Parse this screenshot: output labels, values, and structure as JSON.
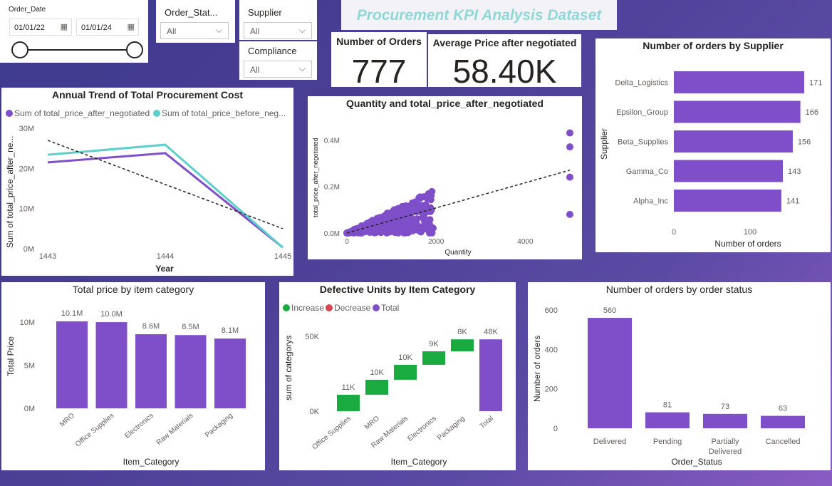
{
  "header": {
    "title": "Procurement KPI Analysis Dataset"
  },
  "slicers": {
    "order_date": {
      "label": "Order_Date",
      "start": "01/01/22",
      "end": "01/01/24"
    },
    "order_status": {
      "label": "Order_Stat...",
      "value": "All"
    },
    "supplier": {
      "label": "Supplier",
      "value": "All"
    },
    "compliance": {
      "label": "Compliance",
      "value": "All"
    }
  },
  "cards": {
    "orders": {
      "label": "Number of Orders",
      "value": "777"
    },
    "avg_price": {
      "label": "Average Price after negotiated",
      "value": "58.40K"
    }
  },
  "charts": {
    "annual_trend": {
      "title": "Annual Trend of Total Procurement Cost",
      "legend1": "Sum of total_price_after_negotiated",
      "legend2": "Sum of total_price_before_neg...",
      "ylabel": "Sum of total_price_after_ne...",
      "xlabel": "Year",
      "yticks": [
        "30M",
        "20M",
        "10M",
        "0M"
      ],
      "xticks": [
        "1443",
        "1444",
        "1445"
      ]
    },
    "scatter": {
      "title": "Quantity and total_price_after_negotiated",
      "ylabel": "total_price_after_negotiated",
      "xlabel": "Quantity",
      "yticks": [
        "0.4M",
        "0.2M",
        "0.0M"
      ],
      "xticks": [
        "0",
        "2000",
        "4000"
      ]
    },
    "supplier": {
      "title": "Number of orders by Supplier",
      "ylabel": "Supplier",
      "xlabel": "Number of orders",
      "xticks": [
        "0",
        "100"
      ]
    },
    "item_category": {
      "title": "Total price by item category",
      "ylabel": "Total Price",
      "xlabel": "Item_Category",
      "yticks": [
        "10M",
        "5M",
        "0M"
      ]
    },
    "defective": {
      "title": "Defective Units by Item Category",
      "legend": [
        "Increase",
        "Decrease",
        "Total"
      ],
      "ylabel": "sum of categorys",
      "xlabel": "Item_Category",
      "yticks": [
        "50K",
        "0K"
      ]
    },
    "order_status": {
      "title": "Number of orders by order status",
      "ylabel": "Number of orders",
      "xlabel": "Order_Status",
      "yticks": [
        "600",
        "400",
        "200",
        "0"
      ]
    }
  },
  "colors": {
    "purple": "#7f4fc9",
    "teal": "#5ecfcb",
    "green": "#1aab40",
    "red": "#d64550",
    "title_teal": "#8ed8d6"
  },
  "chart_data": [
    {
      "type": "line",
      "title": "Annual Trend of Total Procurement Cost",
      "x": [
        "1443",
        "1444",
        "1445"
      ],
      "series": [
        {
          "name": "Sum of total_price_after_negotiated",
          "values": [
            21.5,
            23.8,
            0.3
          ]
        },
        {
          "name": "Sum of total_price_before_neg...",
          "values": [
            23.4,
            25.9,
            0.3
          ]
        }
      ],
      "trend": [
        27,
        16,
        5
      ],
      "ylim": [
        0,
        30
      ],
      "xlabel": "Year",
      "ylabel": "Sum of total_price_after_ne..."
    },
    {
      "type": "scatter",
      "title": "Quantity and total_price_after_negotiated",
      "xlabel": "Quantity",
      "ylabel": "total_price_after_negotiated",
      "xlim": [
        0,
        5000
      ],
      "ylim": [
        0,
        0.45
      ],
      "outliers": [
        [
          5000,
          0.43
        ],
        [
          5000,
          0.37
        ],
        [
          5000,
          0.24
        ],
        [
          5000,
          0.08
        ]
      ],
      "trend": [
        [
          0,
          0.0
        ],
        [
          5000,
          0.27
        ]
      ]
    },
    {
      "type": "bar",
      "title": "Number of orders by Supplier",
      "categories": [
        "Delta_Logistics",
        "Epsilon_Group",
        "Beta_Supplies",
        "Gamma_Co",
        "Alpha_Inc"
      ],
      "values": [
        171,
        166,
        156,
        143,
        141
      ],
      "xlabel": "Number of orders",
      "ylabel": "Supplier"
    },
    {
      "type": "bar",
      "title": "Total price by item category",
      "categories": [
        "MRO",
        "Office Supplies",
        "Electronics",
        "Raw Materials",
        "Packaging"
      ],
      "values": [
        10.1,
        10.0,
        8.6,
        8.5,
        8.1
      ],
      "labels": [
        "10.1M",
        "10.0M",
        "8.6M",
        "8.5M",
        "8.1M"
      ],
      "ylim": [
        0,
        11
      ],
      "xlabel": "Item_Category",
      "ylabel": "Total Price"
    },
    {
      "type": "bar",
      "title": "Defective Units by Item Category",
      "categories": [
        "Office Supplies",
        "MRO",
        "Raw Materials",
        "Electronics",
        "Packaging",
        "Total"
      ],
      "values": [
        11,
        10,
        10,
        9,
        8,
        48
      ],
      "labels": [
        "11K",
        "10K",
        "10K",
        "9K",
        "8K",
        "48K"
      ],
      "ylim": [
        0,
        55
      ],
      "xlabel": "Item_Category",
      "ylabel": "sum of categorys"
    },
    {
      "type": "bar",
      "title": "Number of orders by order status",
      "categories": [
        "Delivered",
        "Pending",
        "Partially Delivered",
        "Cancelled"
      ],
      "values": [
        560,
        81,
        73,
        63
      ],
      "ylim": [
        0,
        650
      ],
      "xlabel": "Order_Status",
      "ylabel": "Number of orders"
    }
  ]
}
